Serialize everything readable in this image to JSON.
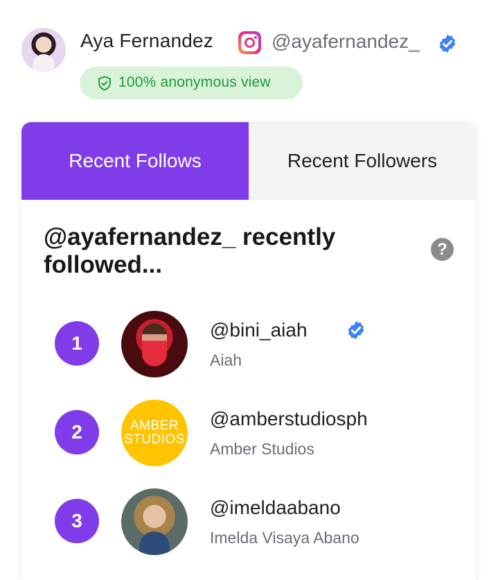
{
  "profile": {
    "name": "Aya Fernandez",
    "handle": "@ayafernandez_",
    "anonymous_badge": "100% anonymous view"
  },
  "tabs": [
    {
      "label": "Recent Follows",
      "active": true
    },
    {
      "label": "Recent Followers",
      "active": false
    }
  ],
  "section": {
    "title": "@ayafernandez_ recently followed...",
    "help": "?"
  },
  "follows": [
    {
      "rank": "1",
      "handle": "@bini_aiah",
      "name": "Aiah",
      "verified": true
    },
    {
      "rank": "2",
      "handle": "@amberstudiosph",
      "name": "Amber Studios",
      "verified": false,
      "avatar_text": [
        "AMBER",
        "STUDIOS"
      ]
    },
    {
      "rank": "3",
      "handle": "@imeldaabano",
      "name": "Imelda Visaya Abano",
      "verified": false
    }
  ],
  "colors": {
    "accent": "#7f3ce8",
    "verified": "#3b82f6",
    "badge_bg": "#d9f3d9",
    "badge_text": "#1e9a3a"
  }
}
